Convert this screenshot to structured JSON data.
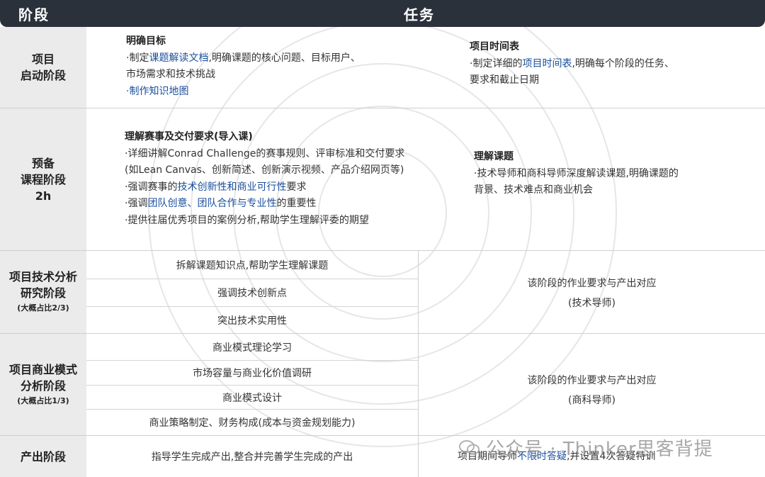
{
  "header": {
    "stage": "阶段",
    "task": "任务"
  },
  "stages": [
    {
      "lines": [
        "项目",
        "启动阶段"
      ],
      "sub": ""
    },
    {
      "lines": [
        "预备",
        "课程阶段",
        "2h"
      ],
      "sub": ""
    },
    {
      "lines": [
        "项目技术分析",
        "研究阶段"
      ],
      "sub": "(大概占比2/3)"
    },
    {
      "lines": [
        "项目商业模式",
        "分析阶段"
      ],
      "sub": "(大概占比1/3)"
    },
    {
      "lines": [
        "产出阶段"
      ],
      "sub": ""
    }
  ],
  "kickoff": {
    "left": {
      "title": "明确目标",
      "l1_pre": "·制定",
      "l1_hl": "课题解读文档",
      "l1_post": ",明确课题的核心问题、目标用户、",
      "l2": "市场需求和技术挑战",
      "l3": "·制作知识地图"
    },
    "right": {
      "title": "项目时间表",
      "l1_pre": "·制定详细的",
      "l1_hl": "项目时间表",
      "l1_post": ",明确每个阶段的任务、",
      "l2": "要求和截止日期"
    }
  },
  "prep": {
    "left": {
      "title": "理解赛事及交付要求(导入课)",
      "l1": "·详细讲解Conrad Challenge的赛事规则、评审标准和交付要求",
      "l2": "(如Lean Canvas、创新简述、创新演示视频、产品介绍网页等)",
      "l3_pre": "·强调赛事的",
      "l3_hl": "技术创新性和商业可行性",
      "l3_post": "要求",
      "l4_pre": "·强调",
      "l4_hl": "团队创意、团队合作与专业性",
      "l4_post": "的重要性",
      "l5": "·提供往届优秀项目的案例分析,帮助学生理解评委的期望"
    },
    "right": {
      "title": "理解课题",
      "l1": "·技术导师和商科导师深度解读课题,明确课题的",
      "l2": "背景、技术难点和商业机会"
    }
  },
  "tech": {
    "items": [
      "拆解课题知识点,帮助学生理解课题",
      "强调技术创新点",
      "突出技术实用性"
    ],
    "right_l1": "该阶段的作业要求与产出对应",
    "right_l2": "(技术导师)"
  },
  "biz": {
    "items": [
      "商业模式理论学习",
      "市场容量与商业化价值调研",
      "商业模式设计",
      "商业策略制定、财务构成(成本与资金规划能力)"
    ],
    "right_l1": "该阶段的作业要求与产出对应",
    "right_l2": "(商科导师)"
  },
  "output": {
    "left": "指导学生完成产出,整合并完善学生完成的产出",
    "right_pre": "项目期间导师",
    "right_hl": "不限时答疑",
    "right_post": ",并设置4次答疑特训"
  },
  "watermark": "公众号 · Thinker思客背提",
  "colors": {
    "header_bg": "#2b313b",
    "stage_bg": "#ebebeb",
    "highlight": "#1b4f9c"
  }
}
